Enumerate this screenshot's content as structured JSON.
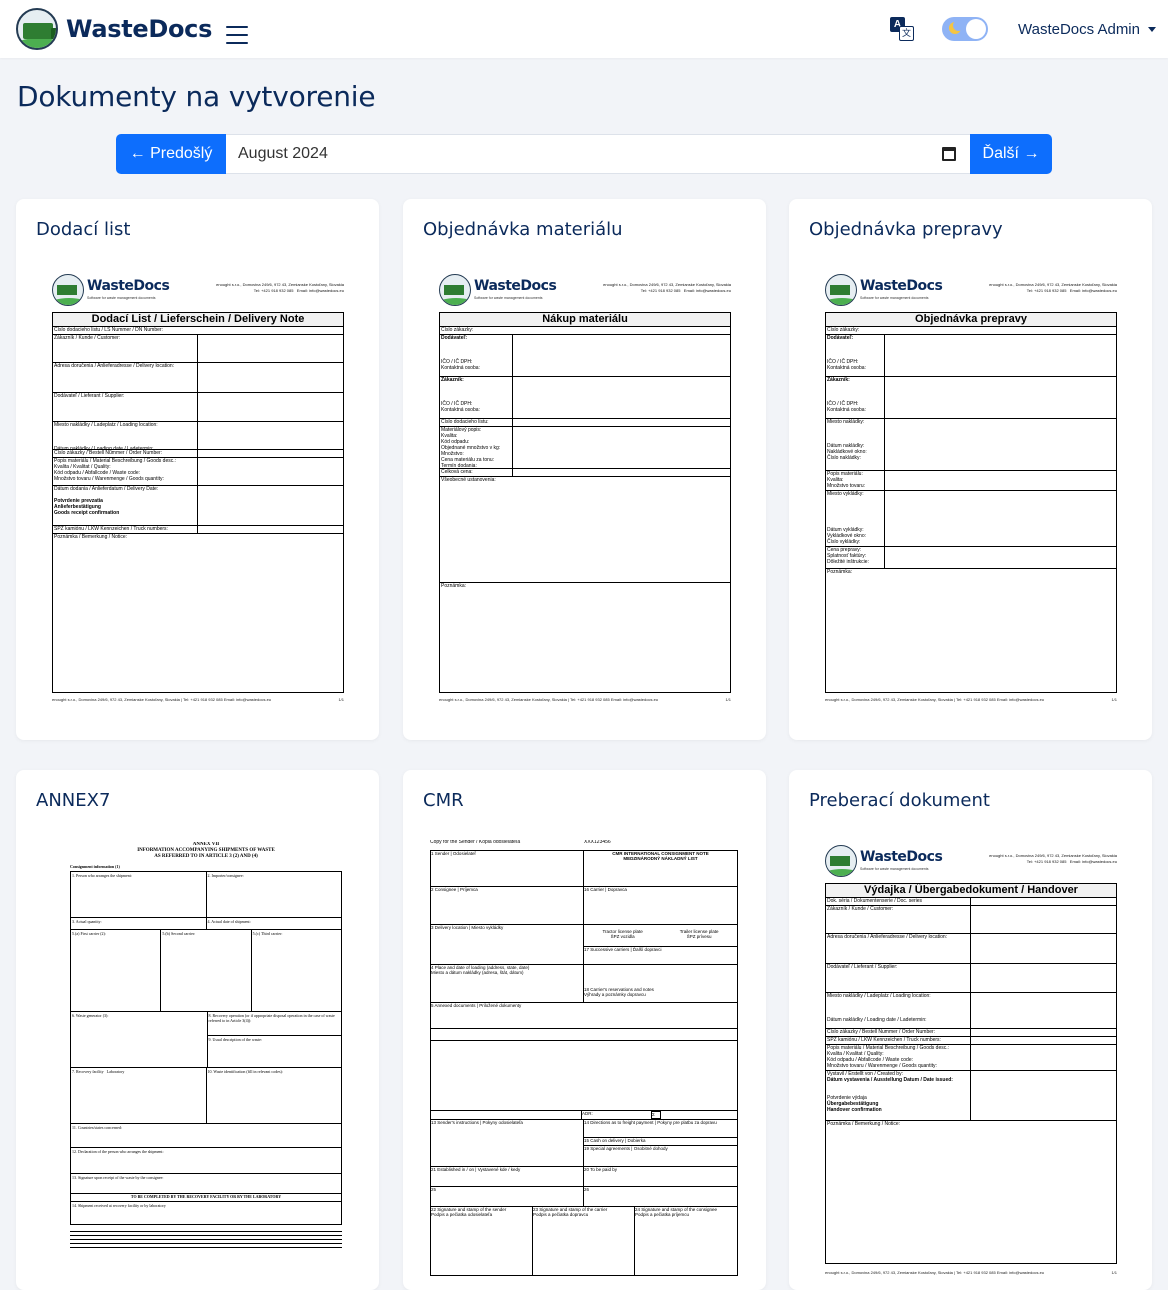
{
  "nav": {
    "brand": "WasteDocs",
    "user": "WasteDocs Admin"
  },
  "page": {
    "title": "Dokumenty na vytvorenie"
  },
  "month_nav": {
    "prev": "← Predošlý",
    "month": "August 2024",
    "next": "Ďalší →"
  },
  "cards": [
    {
      "title": "Dodací list",
      "preview": {
        "logo_text": "WasteDocs",
        "logo_sub": "Software for waste management documents",
        "address_1": "enought s.r.o., Domovina 249/6, 972 43, Zemianske Kostoľany, Slovakia",
        "address_2": "Tel: +421 918 932 085",
        "address_3": "Email: info@wastedocs.eu",
        "form_title": "Dodací List / Lieferschein / Delivery Note",
        "rows": [
          "Číslo dodacieho listu / LS Nummer / DN Number:",
          "Zákazník / Kunde / Customer:",
          "Adresa doručenia / Anlieferadresse / Delivery location:",
          "Dodávateľ / Lieferant / Supplier:",
          "Miesto nakládky / Ladeplatz / Loading location:",
          "Dátum nakládky / Loading date / Ladetermin:",
          "Číslo zákazky / Bestell Nummer / Order Number:",
          "Popis materiálu / Material Beschreibung / Goods desc.:",
          "Kvalita / Kvalitat / Quality:",
          "Kód odpadu / Abfallcode / Waste code:",
          "Množstvo tovaru / Warenmenge / Goods quantity:",
          "Dátum dodania / Anlieferdatum / Delivery Date:",
          "Potvrdenie prevzatia",
          "Anlieferbestätigung",
          "Goods receipt confirmation",
          "ŠPZ kamiónu / LKW Kennzeichen / Truck numbers:",
          "Poznámka / Bemerkung / Notice:"
        ],
        "footer": "enought s.r.o., Domovina 249/6, 972 43, Zemianske Kostoľany, Slovakia | Tel: +421 918 932 085 Email: info@wastedocs.eu",
        "page": "1/1"
      }
    },
    {
      "title": "Objednávka materiálu",
      "preview": {
        "form_title": "Nákup materiálu",
        "rows": [
          "Číslo zákazky:",
          "Dodávateľ:",
          "IČO / IČ DPH:",
          "Kontaktná osoba:",
          "Zákazník:",
          "IČO / IČ DPH:",
          "Kontaktná osoba:",
          "Číslo dodacieho listu:",
          "Materiálový popis:",
          "Kvalita:",
          "Kód odpadu:",
          "Objednané množstvo v kg:",
          "Množstvo:",
          "Cena materiálu za tonu:",
          "Termín dodania:",
          "Celková cena:",
          "Všeobecné ustanovenia:",
          "Poznámka:"
        ]
      }
    },
    {
      "title": "Objednávka prepravy",
      "preview": {
        "form_title": "Objednávka prepravy",
        "rows": [
          "Číslo zákazky:",
          "Dodávateľ:",
          "IČO / IČ DPH:",
          "Kontaktná osoba:",
          "Zákazník:",
          "IČO / IČ DPH:",
          "Kontaktná osoba:",
          "Miesto nakládky:",
          "Dátum nakládky:",
          "Nakládkové okno:",
          "Číslo nakládky:",
          "Popis materiálu:",
          "Kvalita:",
          "Množstvo tovaru:",
          "Miesto vykládky:",
          "Dátum vykládky:",
          "Vykládkové okno:",
          "Číslo vykládky:",
          "Cena prepravy:",
          "Splatnosť faktúry:",
          "Dôležité inštrukcie:",
          "Poznámka:"
        ]
      }
    },
    {
      "title": "ANNEX7",
      "preview": {
        "heading_1": "ANNEX VII",
        "heading_2": "INFORMATION ACCOMPANYING SHIPMENTS OF WASTE",
        "heading_3": "AS REFERRED TO IN ARTICLE 3 (2) AND (4)",
        "consignment": "Consignment information (1)",
        "cells": [
          "1. Person who arranges the shipment:",
          "2. Importer/consignee:",
          "3. Actual quantity:",
          "4. Actual date of shipment:",
          "5.(a) First carrier (2):",
          "5.(b) Second carrier:",
          "5.(c) Third carrier:",
          "6. Waste generator (3):",
          "8. Recovery operation (or if appropriate disposal operation in the case of waste referred to in Article 3(4)):",
          "9. Usual description of the waste:",
          "7. Recovery facility",
          "Laboratory",
          "10. Waste identification (fill in relevant codes):",
          "11. Countries/states concerned:",
          "12. Declaration of the person who arranges the shipment:",
          "13. Signature upon receipt of the waste by the consignee:",
          "TO BE COMPLETED BY THE RECOVERY FACILITY OR BY THE LABORATORY",
          "14. Shipment received at recovery facility or by laboratory"
        ]
      }
    },
    {
      "title": "CMR",
      "preview": {
        "copy": "Copy for the Sender / Kópia odosielateľa",
        "number": "XXX123456",
        "head_1": "CMR INTERNATIONAL CONSIGNMENT NOTE",
        "head_2": "MEDZINÁRODNÝ NÁKLADNÝ LIST",
        "fields": [
          "1 Sender | Odosielateľ",
          "2 Consignee | Príjemca",
          "16 Carrier | Dopravca",
          "3 Delivery location | Miesto vykládky",
          "Tractor license plate",
          "ŠPZ vozidla",
          "Trailer license plate",
          "ŠPZ prívesu",
          "17 Successive carriers | Ďalší dopravci",
          "4 Place and date of loading (address, state, date)",
          "Miesto a dátum nakládky (adresa, štát, dátum)",
          "18 Carrier's reservations and notes",
          "Výhrady a poznámky dopravcu",
          "5 Annexed documents | Priložené dokumenty",
          "ADR:",
          "Σ",
          "13 Sender's instructions | Pokyny odosielateľa",
          "14 Directions as to freight payment | Pokyny pre platbu za dopravu",
          "15 Cash on delivery | Dobierka",
          "19 Special agreements | Osobitné dohody",
          "21 Established in / on | Vystavené kde / kedy",
          "20 To be paid by",
          "25",
          "26",
          "22 Signature and stamp of the sender",
          "Podpis a pečiatka odosielateľa",
          "23 Signature and stamp of the carrier",
          "Podpis a pečiatka dopravcu",
          "24 Signature and stamp of the consignee",
          "Podpis a pečiatka príjemcu"
        ]
      }
    },
    {
      "title": "Preberací dokument",
      "preview": {
        "form_title": "Výdajka / Übergabedokument / Handover",
        "rows": [
          "Dok. séria / Dokumentenserie / Doc. series",
          "Zákazník / Kunde / Customer:",
          "Adresa doručenia / Anlieferadresse / Delivery location:",
          "Dodávateľ / Lieferant / Supplier:",
          "Miesto nakládky / Ladeplatz / Loading location:",
          "Dátum nakládky / Loading date / Ladetermin:",
          "Číslo zákazky / Bestell Nummer / Order Number:",
          "ŠPZ kamiónu / LKW Kennzeichen / Truck numbers:",
          "Popis materiálu / Material Beschreibung / Goods desc.:",
          "Kvalita / Kvalitat / Quality:",
          "Kód odpadu / Abfallcode / Waste code:",
          "Množstvo tovaru / Warenmenge / Goods quantity:",
          "Vystavil / Erstellt von / Created by:",
          "Dátum vystavenia / Ausstellung Datum / Date issued:",
          "Potvrdenie výdaja",
          "Übergabebestätigung",
          "Handover confirmation",
          "Poznámka / Bemerkung / Notice:"
        ]
      }
    }
  ]
}
